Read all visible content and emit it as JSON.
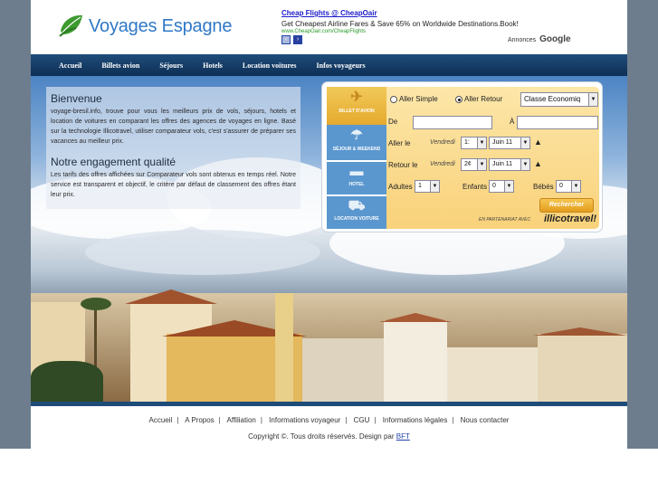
{
  "logo": {
    "text": "Voyages Espagne",
    "icon": "leaf-icon"
  },
  "ads": {
    "title": "Cheap Flights @ CheapOair",
    "text": "Get Cheapest Airline Fares & Save 65% on Worldwide Destinations.Book!",
    "url": "www.CheapOair.com/CheapFlights",
    "label": "Annonces",
    "brand": "Google"
  },
  "nav": {
    "items": [
      "Accueil",
      "Billets avion",
      "Séjours",
      "Hotels",
      "Location voitures",
      "Infos voyageurs"
    ]
  },
  "welcome": {
    "title": "Bienvenue",
    "text": "voyage-bresil.info, trouve pour vous les meilleurs prix de vols, séjours, hotels et location de voitures en comparant les offres des agences de voyages en ligne. Basé sur la technologie Illicotravel, utiliser comparateur vols, c'est s'assurer de préparer ses vacances au meilleur prix.",
    "title2": "Notre engagement qualité",
    "text2": "Les tarifs des offres affichées sur Comparateur vols sont obtenus en temps réel. Notre service est transparent et objectif, le critère par défaut de classement des offres étant leur prix."
  },
  "widget": {
    "tabs": [
      "BILLET D'AVION",
      "SÉJOUR & WEEKEND",
      "HOTEL",
      "LOCATION VOITURE"
    ],
    "trip_one_way": "Aller Simple",
    "trip_return": "Aller Retour",
    "class_value": "Classe Economiq",
    "from_label": "De",
    "to_label": "À",
    "depart_label": "Aller le",
    "return_label": "Retour le",
    "depart_day": "Vendredi",
    "depart_date": "1:",
    "depart_month": "Juin 11",
    "return_day": "Vendredi",
    "return_date": "2¢",
    "return_month": "Juin 11",
    "adults_label": "Adultes",
    "adults_value": "1",
    "children_label": "Enfants",
    "children_value": "0",
    "babies_label": "Bébés",
    "babies_value": "0",
    "search_label": "Rechercher",
    "partner_text": "EN PARTENARIAT AVEC",
    "partner_brand": "illicotravel!"
  },
  "footer": {
    "links": [
      "Accueil",
      "A Propos",
      "Affiliation",
      "Informations voyageur",
      "CGU",
      "Informations légales",
      "Nous contacter"
    ],
    "copyright": "Copyright ©. Tous droits réservés. Design par",
    "designer": "BFT"
  }
}
